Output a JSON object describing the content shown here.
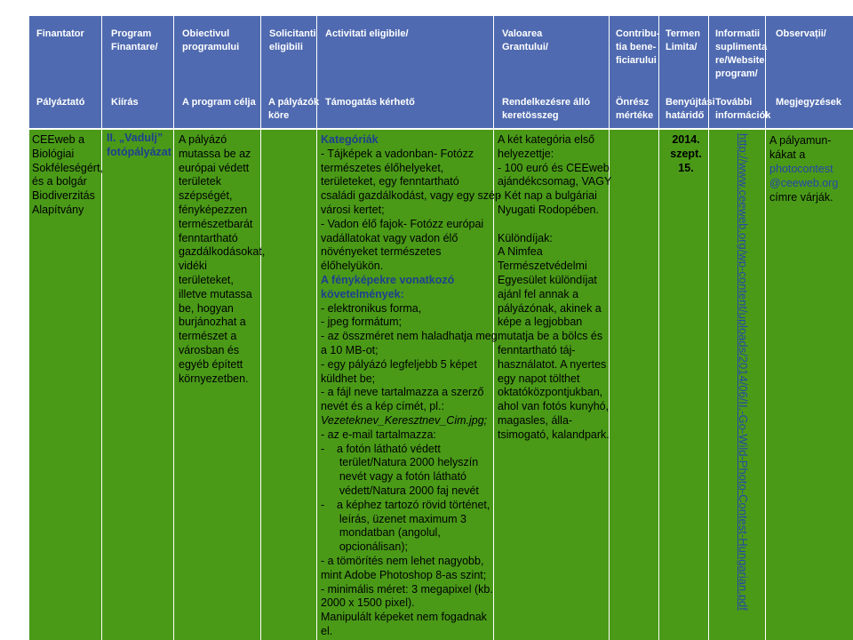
{
  "header_ro": [
    "Finantator",
    "Program\nFinantare/",
    "Obiectivul\nprogramului",
    "Solicitanti\neligibili",
    "Activitati eligibile/",
    "Valoarea\nGrantului/",
    "Contribu-\ntia bene-\nficiarului",
    "Termen\nLimita/",
    "Informatii\nsuplimenta\nre/Website\nprogram/",
    "Observații/"
  ],
  "header_hu": [
    "Pályáztató",
    "Kiírás",
    "A program célja",
    "A pályázók\nköre",
    "Támogatás kérhető",
    "Rendelkezésre álló\nkeretösszeg",
    "Önrész\nmértéke",
    "Benyújtási\nhatáridő",
    "További\ninformációk",
    "Megjegyzések"
  ],
  "row": {
    "funder": "CEEweb a Biológiai Sokféleségért, és a bolgár Biodiverzitás Alapítvány",
    "program": "II. „Vadulj” fotópályázat",
    "goal": "A pályázó mutassa be az európai védett területek szépségét, fényképezzen természetbarát fenntartható gazdálkodásokat, vidéki területeket, illetve mutassa be, hogyan burjánozhat a természet a városban és egyéb épített környezetben.",
    "activities_lines": [
      {
        "t": "Kategóriák",
        "c": "tblue bold"
      },
      {
        "t": "- Tájképek a vadonban- Fotózz",
        "c": "bold-dash"
      },
      {
        "t": "természetes élőhelyeket,",
        "c": ""
      },
      {
        "t": "területeket, egy fenntartható",
        "c": ""
      },
      {
        "t": "családi gazdálkodást, vagy egy szép",
        "c": ""
      },
      {
        "t": "városi kertet;",
        "c": ""
      },
      {
        "t": "- Vadon élő fajok- Fotózz európai",
        "c": ""
      },
      {
        "t": "vadállatokat vagy vadon élő",
        "c": ""
      },
      {
        "t": "növényeket természetes",
        "c": ""
      },
      {
        "t": "élőhelyükön.",
        "c": ""
      },
      {
        "t": "A fényképekre vonatkozó",
        "c": "tblue bold"
      },
      {
        "t": "követelmények:",
        "c": "tblue bold"
      },
      {
        "t": "- elektronikus forma,",
        "c": ""
      },
      {
        "t": "- jpeg formátum;",
        "c": ""
      },
      {
        "t": "- az összméret nem haladhatja meg",
        "c": ""
      },
      {
        "t": "a 10 MB-ot;",
        "c": ""
      },
      {
        "t": "- egy pályázó legfeljebb 5 képet",
        "c": ""
      },
      {
        "t": "küldhet be;",
        "c": ""
      },
      {
        "t": "- a fájl neve tartalmazza a szerző",
        "c": ""
      },
      {
        "t": "nevét és a kép címét, pl.:",
        "c": ""
      },
      {
        "t": "Vezeteknev_Keresztnev_Cim.jpg;",
        "c": "ital"
      },
      {
        "t": "- az e-mail tartalmazza:",
        "c": ""
      },
      {
        "t": "-    a fotón látható védett",
        "c": ""
      },
      {
        "t": "      terület/Natura 2000 helyszín",
        "c": ""
      },
      {
        "t": "      nevét vagy a fotón látható",
        "c": ""
      },
      {
        "t": "      védett/Natura 2000 faj nevét",
        "c": ""
      },
      {
        "t": "-    a képhez tartozó rövid történet,",
        "c": ""
      },
      {
        "t": "      leírás, üzenet maximum 3",
        "c": ""
      },
      {
        "t": "      mondatban (angolul,",
        "c": ""
      },
      {
        "t": "      opcionálisan);",
        "c": ""
      },
      {
        "t": "- a tömörítés nem lehet nagyobb,",
        "c": ""
      },
      {
        "t": "mint Adobe Photoshop 8-as szint;",
        "c": ""
      },
      {
        "t": "- minimális méret: 3 megapixel (kb.",
        "c": ""
      },
      {
        "t": "2000 x 1500 pixel).",
        "c": ""
      },
      {
        "t": "Manipulált képeket nem fogadnak",
        "c": ""
      },
      {
        "t": "el.",
        "c": ""
      }
    ],
    "grant_lines": [
      "A két kategória első",
      "helyezettje:",
      "- 100 euró és CEEweb",
      "ajándékcsomag, VAGY",
      "-  Két nap a bulgáriai",
      "Nyugati Rodopében.",
      "",
      "Különdíjak:",
      "A Nimfea",
      "Természetvédelmi",
      "Egyesület különdíjat",
      "ajánl fel annak a",
      "pályázónak, akinek a",
      "képe a legjobban",
      "mutatja be a bölcs és",
      "fenntartható táj-",
      "használatot. A nyertes",
      "egy napot tölthet",
      "oktatóközpontjukban,",
      "ahol van fotós kunyhó,",
      "magasles, álla-",
      "tsimogató, kalandpark."
    ],
    "deadline_line1": "2014.",
    "deadline_line2": "szept. 15.",
    "info_link": "http://www.ceeweb.org/wp-content/uploads/2014/06/II.-Go-Wild-Photo-Contest-Hungarian.pdf",
    "notes_line1": "A pályamun-",
    "notes_line2": "kákat a",
    "notes_email1": "photocontest",
    "notes_email2": "@ceeweb.org",
    "notes_line3": "címre várják."
  },
  "colors": {
    "header_bg": "#4f6ab0",
    "body_bg": "#4a9a18",
    "link": "#2846a8"
  }
}
